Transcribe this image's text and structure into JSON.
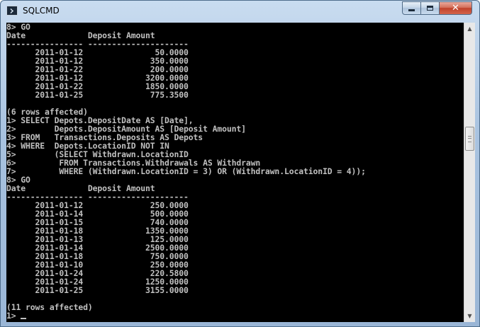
{
  "window": {
    "title": "SQLCMD",
    "icon": "console-app-icon",
    "controls": {
      "minimize": "minimize-icon",
      "maximize": "maximize-icon",
      "close_label": "✕"
    }
  },
  "console": {
    "text_color": "#c0c0c0",
    "background": "#000000",
    "lines": [
      "8> GO",
      "Date             Deposit Amount",
      "---------------- ---------------------",
      "      2011-01-12               50.0000",
      "      2011-01-12              350.0000",
      "      2011-01-22              200.0000",
      "      2011-01-12             3200.0000",
      "      2011-01-22             1850.0000",
      "      2011-01-25              775.3500",
      "",
      "(6 rows affected)",
      "1> SELECT Depots.DepositDate AS [Date],",
      "2>        Depots.DepositAmount AS [Deposit Amount]",
      "3> FROM   Transactions.Deposits AS Depots",
      "4> WHERE  Depots.LocationID NOT IN",
      "5>        (SELECT Withdrawn.LocationID",
      "6>         FROM Transactions.Withdrawals AS Withdrawn",
      "7>         WHERE (Withdrawn.LocationID = 3) OR (Withdrawn.LocationID = 4));",
      "8> GO",
      "Date             Deposit Amount",
      "---------------- ---------------------",
      "      2011-01-12              250.0000",
      "      2011-01-14              500.0000",
      "      2011-01-15              740.0000",
      "      2011-01-18             1350.0000",
      "      2011-01-13              125.0000",
      "      2011-01-14             2500.0000",
      "      2011-01-18              750.0000",
      "      2011-01-10              250.0000",
      "      2011-01-24              220.5800",
      "      2011-01-24             1250.0000",
      "      2011-01-25             3155.0000",
      "",
      "(11 rows affected)"
    ],
    "prompt": "1> "
  },
  "scrollbar": {
    "up_icon": "scroll-up-arrow-icon",
    "down_icon": "scroll-down-arrow-icon",
    "up_glyph": "▲",
    "down_glyph": "▼"
  }
}
